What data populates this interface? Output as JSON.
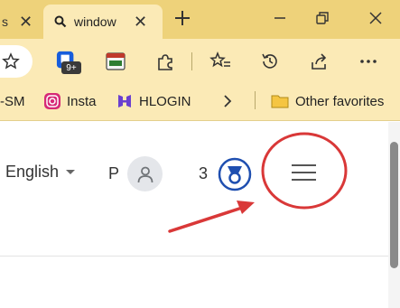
{
  "browser": {
    "tabs": [
      {
        "label": "s"
      },
      {
        "label": "window"
      }
    ],
    "bookmarks": [
      {
        "label": "-SM"
      },
      {
        "label": "Insta"
      },
      {
        "label": "HLOGIN"
      },
      {
        "label": "Other favorites"
      }
    ],
    "extension_badge": "9+",
    "colors": {
      "tab_strip": "#eed27a",
      "toolbar": "#fbeab6"
    }
  },
  "page": {
    "language": "English",
    "user_initial": "P",
    "achievement_count": "3",
    "accent_color": "#1f4fb0",
    "annotation_color": "#d93838"
  }
}
